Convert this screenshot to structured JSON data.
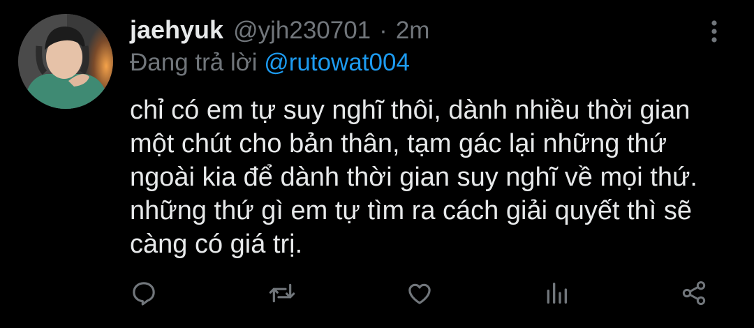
{
  "tweet": {
    "display_name": "jaehyuk",
    "handle": "@yjh230701",
    "separator": "·",
    "time": "2m",
    "reply_prefix": "Đang trả lời",
    "reply_to": "@rutowat004",
    "body_lines": [
      "chỉ có em tự suy nghĩ thôi, dành nhiều thời gian",
      "một chút cho bản thân, tạm gác lại những thứ",
      "ngoài kia để dành thời gian suy nghĩ về mọi thứ.",
      "những thứ gì em tự tìm ra cách giải quyết thì sẽ",
      "càng có giá trị."
    ]
  },
  "icons": {
    "avatar": "avatar-photo",
    "more": "more-vertical-icon",
    "reply": "reply-icon",
    "retweet": "retweet-icon",
    "like": "heart-icon",
    "analytics": "analytics-icon",
    "share": "share-icon"
  },
  "colors": {
    "background": "#000000",
    "text_primary": "#e7e9ea",
    "text_secondary": "#71767b",
    "link": "#1d9bf0",
    "icon": "#71767b"
  }
}
